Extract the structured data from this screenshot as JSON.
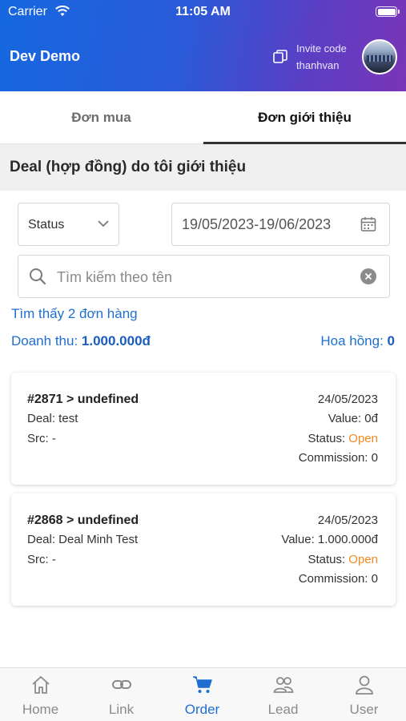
{
  "status_bar": {
    "carrier": "Carrier",
    "time": "11:05 AM"
  },
  "header": {
    "title": "Dev Demo",
    "invite_label": "Invite code",
    "invite_code": "thanhvan"
  },
  "tabs": [
    {
      "label": "Đơn mua",
      "active": false
    },
    {
      "label": "Đơn giới thiệu",
      "active": true
    }
  ],
  "section_title": "Deal (hợp đồng) do tôi giới thiệu",
  "filters": {
    "status_label": "Status",
    "date_range": "19/05/2023-19/06/2023",
    "search_placeholder": "Tìm kiếm theo tên",
    "search_value": ""
  },
  "summary": {
    "found": "Tìm thấy 2 đơn hàng",
    "revenue_label": "Doanh thu: ",
    "revenue_value": "1.000.000đ",
    "commission_label": "Hoa hồng: ",
    "commission_value": "0"
  },
  "orders": [
    {
      "id": "#2871 > undefined",
      "date": "24/05/2023",
      "deal": "Deal: test",
      "value": "Value: 0đ",
      "src": "Src: -",
      "status_label": "Status: ",
      "status_value": "Open",
      "commission": "Commission: 0"
    },
    {
      "id": "#2868 > undefined",
      "date": "24/05/2023",
      "deal": "Deal: Deal Minh Test",
      "value": "Value: 1.000.000đ",
      "src": "Src: -",
      "status_label": "Status: ",
      "status_value": "Open",
      "commission": "Commission: 0"
    }
  ],
  "bottom_nav": [
    {
      "label": "Home",
      "icon": "home-icon",
      "active": false
    },
    {
      "label": "Link",
      "icon": "link-icon",
      "active": false
    },
    {
      "label": "Order",
      "icon": "cart-icon",
      "active": true
    },
    {
      "label": "Lead",
      "icon": "people-icon",
      "active": false
    },
    {
      "label": "User",
      "icon": "user-icon",
      "active": false
    }
  ],
  "colors": {
    "accent": "#1f6fd0",
    "status_open": "#f08a24",
    "header_start": "#1668e0",
    "header_end": "#7a35b8"
  }
}
